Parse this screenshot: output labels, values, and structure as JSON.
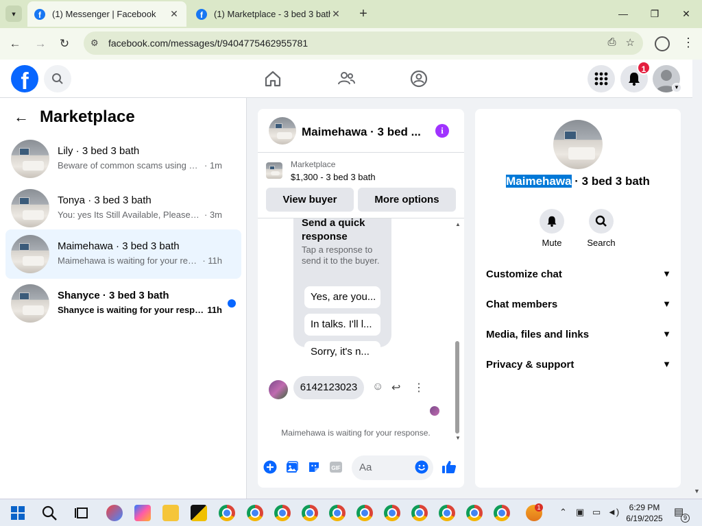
{
  "browser": {
    "tabs": [
      {
        "title": "(1) Messenger | Facebook",
        "active": true
      },
      {
        "title": "(1) Marketplace - 3 bed 3 bath |",
        "active": false
      }
    ],
    "url": "facebook.com/messages/t/9404775462955781"
  },
  "fb_nav": {
    "notification_count": "1"
  },
  "left_panel": {
    "title": "Marketplace",
    "conversations": [
      {
        "name": "Lily · 3 bed 3 bath",
        "preview": "Beware of common scams using pay...",
        "time": "· 1m",
        "unread": false,
        "selected": false
      },
      {
        "name": "Tonya · 3 bed 3 bath",
        "preview": "You: yes Its Still Available, Please Sen...",
        "time": "· 3m",
        "unread": false,
        "selected": false
      },
      {
        "name": "Maimehawa · 3 bed 3 bath",
        "preview": "Maimehawa is waiting for your resp...",
        "time": "· 11h",
        "unread": false,
        "selected": true
      },
      {
        "name": "Shanyce · 3 bed 3 bath",
        "preview": "Shanyce is waiting for your respo...",
        "time": "11h",
        "unread": true,
        "selected": false
      }
    ]
  },
  "chat": {
    "title": "Maimehawa · 3 bed ...",
    "listing": {
      "source": "Marketplace",
      "price_title": "$1,300 - 3 bed 3 bath",
      "view_buyer_label": "View buyer",
      "more_options_label": "More options"
    },
    "quick_response": {
      "title": "Send a quick response",
      "subtitle": "Tap a response to send it to the buyer.",
      "options": [
        "Yes, are you...",
        "In talks. I'll l...",
        "Sorry, it's n..."
      ]
    },
    "message": "6142123023",
    "status": "Maimehawa is waiting for your response.",
    "composer_placeholder": "Aa",
    "accent_color": "#0866ff"
  },
  "right_panel": {
    "name_highlighted": "Maimehawa",
    "name_rest": " · 3 bed 3 bath",
    "actions": [
      {
        "label": "Mute",
        "icon": "bell-icon"
      },
      {
        "label": "Search",
        "icon": "search-icon"
      }
    ],
    "sections": [
      "Customize chat",
      "Chat members",
      "Media, files and links",
      "Privacy & support"
    ]
  },
  "taskbar": {
    "time": "6:29 PM",
    "date": "6/19/2025",
    "notification_badge": "9",
    "app_badge": "1"
  }
}
